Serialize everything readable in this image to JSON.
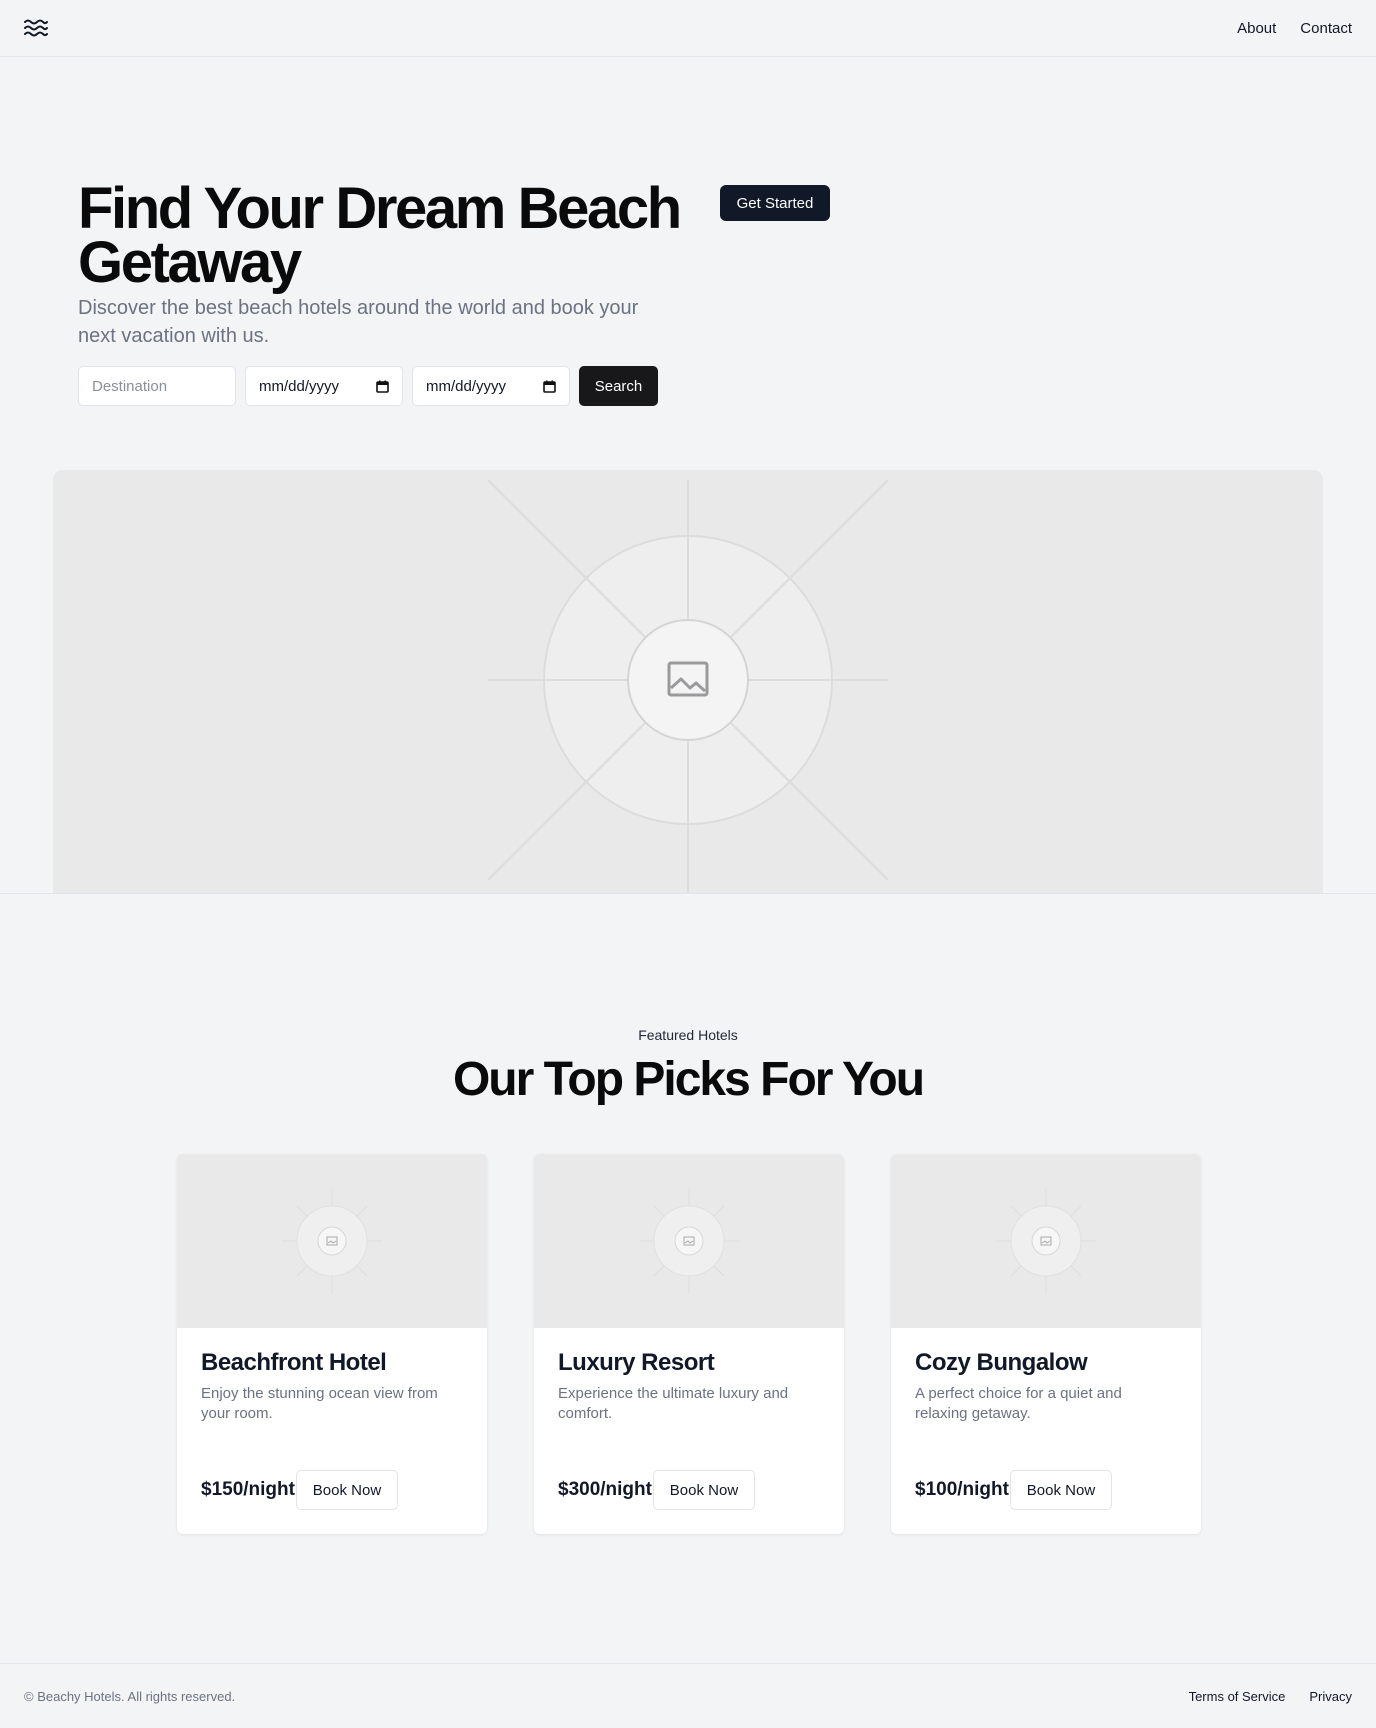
{
  "header": {
    "logo_icon": "waves-icon",
    "nav": [
      {
        "label": "About"
      },
      {
        "label": "Contact"
      }
    ]
  },
  "hero": {
    "title": "Find Your Dream Beach Getaway",
    "subtitle": "Discover the best beach hotels around the world and book your next vacation with us.",
    "cta_label": "Get Started",
    "search": {
      "destination_placeholder": "Destination",
      "checkin_value": "mm/dd/yyyy",
      "checkout_value": "mm/dd/yyyy",
      "search_label": "Search"
    },
    "image_icon": "image-placeholder-icon"
  },
  "featured": {
    "eyebrow": "Featured Hotels",
    "title": "Our Top Picks For You",
    "cards": [
      {
        "name": "Beachfront Hotel",
        "description": "Enjoy the stunning ocean view from your room.",
        "price": "$150/night",
        "button": "Book Now"
      },
      {
        "name": "Luxury Resort",
        "description": "Experience the ultimate luxury and comfort.",
        "price": "$300/night",
        "button": "Book Now"
      },
      {
        "name": "Cozy Bungalow",
        "description": "A perfect choice for a quiet and relaxing getaway.",
        "price": "$100/night",
        "button": "Book Now"
      }
    ]
  },
  "footer": {
    "copyright": "© Beachy Hotels. All rights reserved.",
    "links": [
      {
        "label": "Terms of Service"
      },
      {
        "label": "Privacy"
      }
    ]
  },
  "colors": {
    "page_bg": "#f3f4f6",
    "primary_button": "#111827",
    "placeholder_bg": "#e9e9ea"
  }
}
